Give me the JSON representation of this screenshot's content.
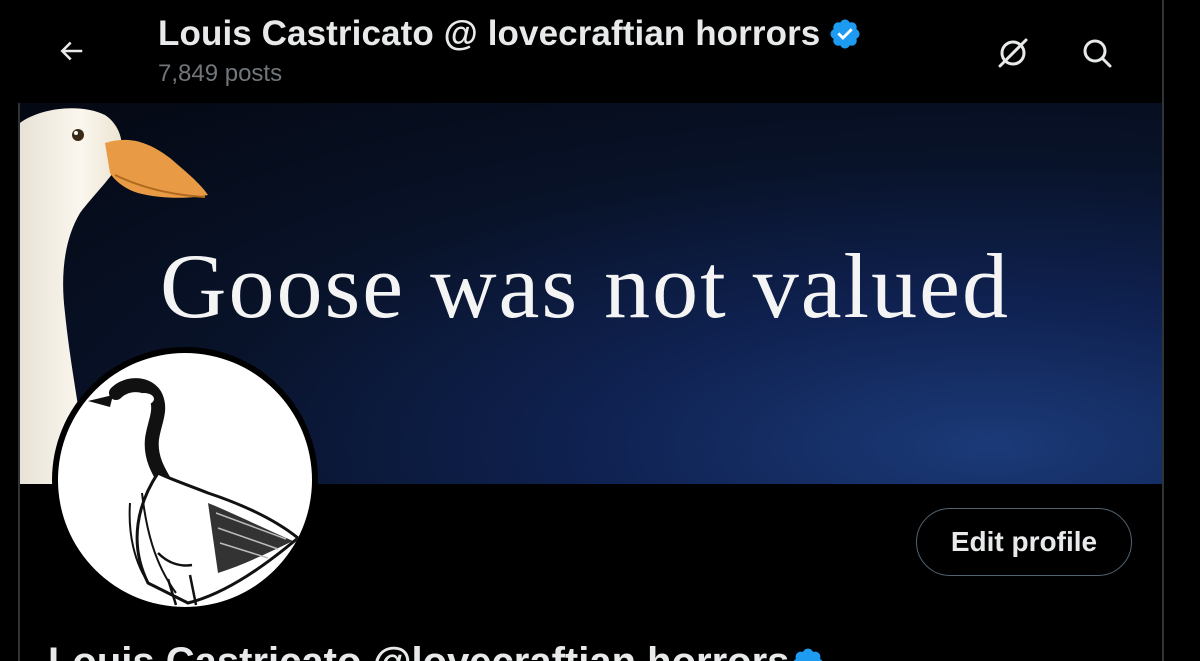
{
  "header": {
    "title": "Louis Castricato @ lovecraftian horrors",
    "posts": "7,849 posts",
    "icons": {
      "back": "arrow-left-icon",
      "grok": "grok-icon",
      "search": "search-icon",
      "verified": "verified-badge-icon"
    }
  },
  "banner": {
    "text": "Goose was not valued"
  },
  "profile": {
    "edit_label": "Edit profile",
    "display_name": "Louis Castricato @lovecraftian horrors"
  },
  "colors": {
    "accent": "#1d9bf0",
    "muted": "#71767b",
    "text": "#e7e9ea",
    "background": "#000000"
  }
}
